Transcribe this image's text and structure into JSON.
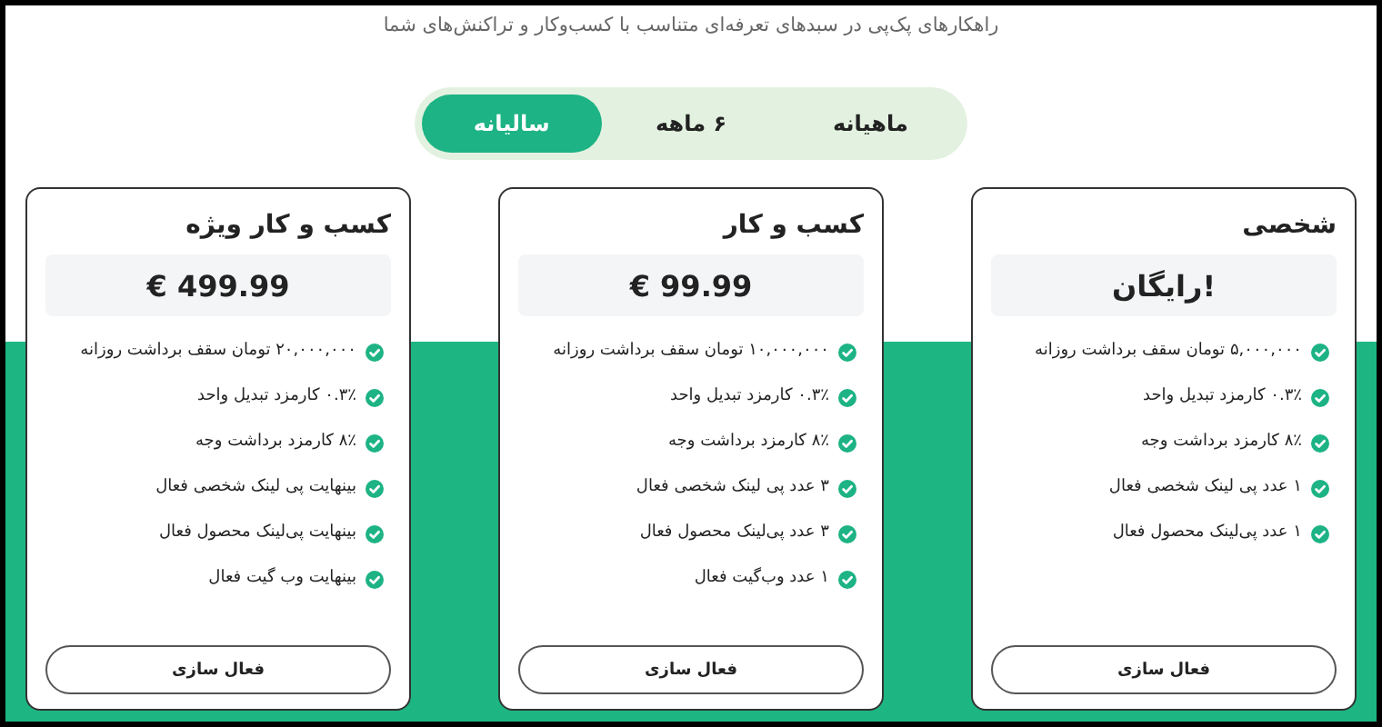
{
  "subtitle": "راهکارهای پک‌پی در سبدهای تعرفه‌ای متناسب با کسب‌وکار و تراکنش‌های شما",
  "tabs": [
    {
      "label": "ماهیانه",
      "selected": false
    },
    {
      "label": "۶ ماهه",
      "selected": false
    },
    {
      "label": "سالیانه",
      "selected": true
    }
  ],
  "plans": [
    {
      "title": "شخصی",
      "price": "رایگان!",
      "features": [
        "۵,۰۰۰,۰۰۰ تومان سقف برداشت روزانه",
        "۰.۳٪ کارمزد تبدیل واحد",
        "۸٪ کارمزد برداشت وجه",
        "۱ عدد پی لینک شخصی فعال",
        "۱ عدد پی‌لینک محصول فعال"
      ],
      "button": "فعال سازی"
    },
    {
      "title": "کسب و کار",
      "price": "€ 99.99",
      "features": [
        "۱۰,۰۰۰,۰۰۰ تومان سقف برداشت روزانه",
        "۰.۳٪ کارمزد تبدیل واحد",
        "۸٪ کارمزد برداشت وجه",
        "۳ عدد پی لینک شخصی فعال",
        "۳ عدد پی‌لینک محصول فعال",
        "۱ عدد وب‌گیت فعال"
      ],
      "button": "فعال سازی"
    },
    {
      "title": "کسب و کار ویژه",
      "price": "€ 499.99",
      "features": [
        "۲۰,۰۰۰,۰۰۰ تومان سقف برداشت روزانه",
        "۰.۳٪ کارمزد تبدیل واحد",
        "۸٪ کارمزد برداشت وجه",
        "بینهایت پی لینک شخصی فعال",
        "بینهایت پی‌لینک محصول فعال",
        "بینهایت وب گیت فعال"
      ],
      "button": "فعال سازی"
    }
  ]
}
